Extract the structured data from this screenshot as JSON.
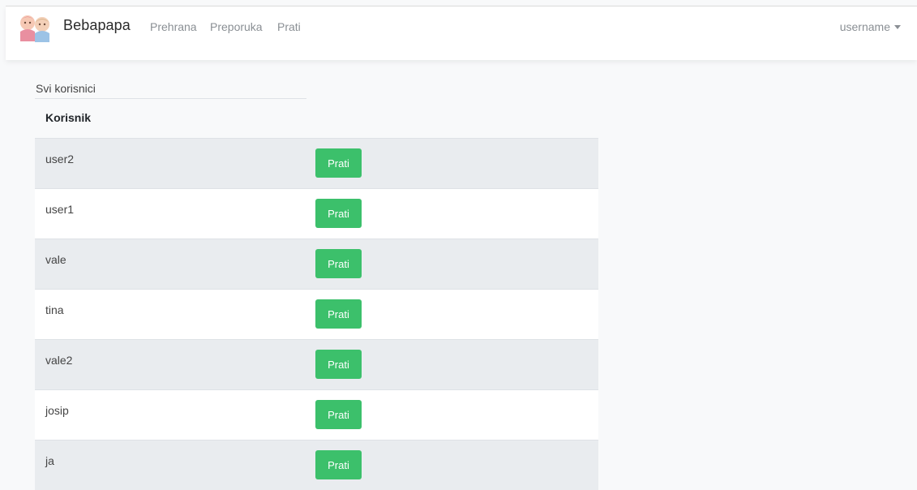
{
  "nav": {
    "brand": "Bebapapa",
    "links": [
      "Prehrana",
      "Preporuka",
      "Prati"
    ],
    "user": "username"
  },
  "page": {
    "title": "Svi korisnici",
    "column_header": "Korisnik"
  },
  "users": [
    {
      "name": "user2",
      "action": "Prati"
    },
    {
      "name": "user1",
      "action": "Prati"
    },
    {
      "name": "vale",
      "action": "Prati"
    },
    {
      "name": "tina",
      "action": "Prati"
    },
    {
      "name": "vale2",
      "action": "Prati"
    },
    {
      "name": "josip",
      "action": "Prati"
    },
    {
      "name": "ja",
      "action": "Prati"
    }
  ],
  "colors": {
    "accent": "#3cc06b",
    "stripe": "#e9ecef"
  }
}
